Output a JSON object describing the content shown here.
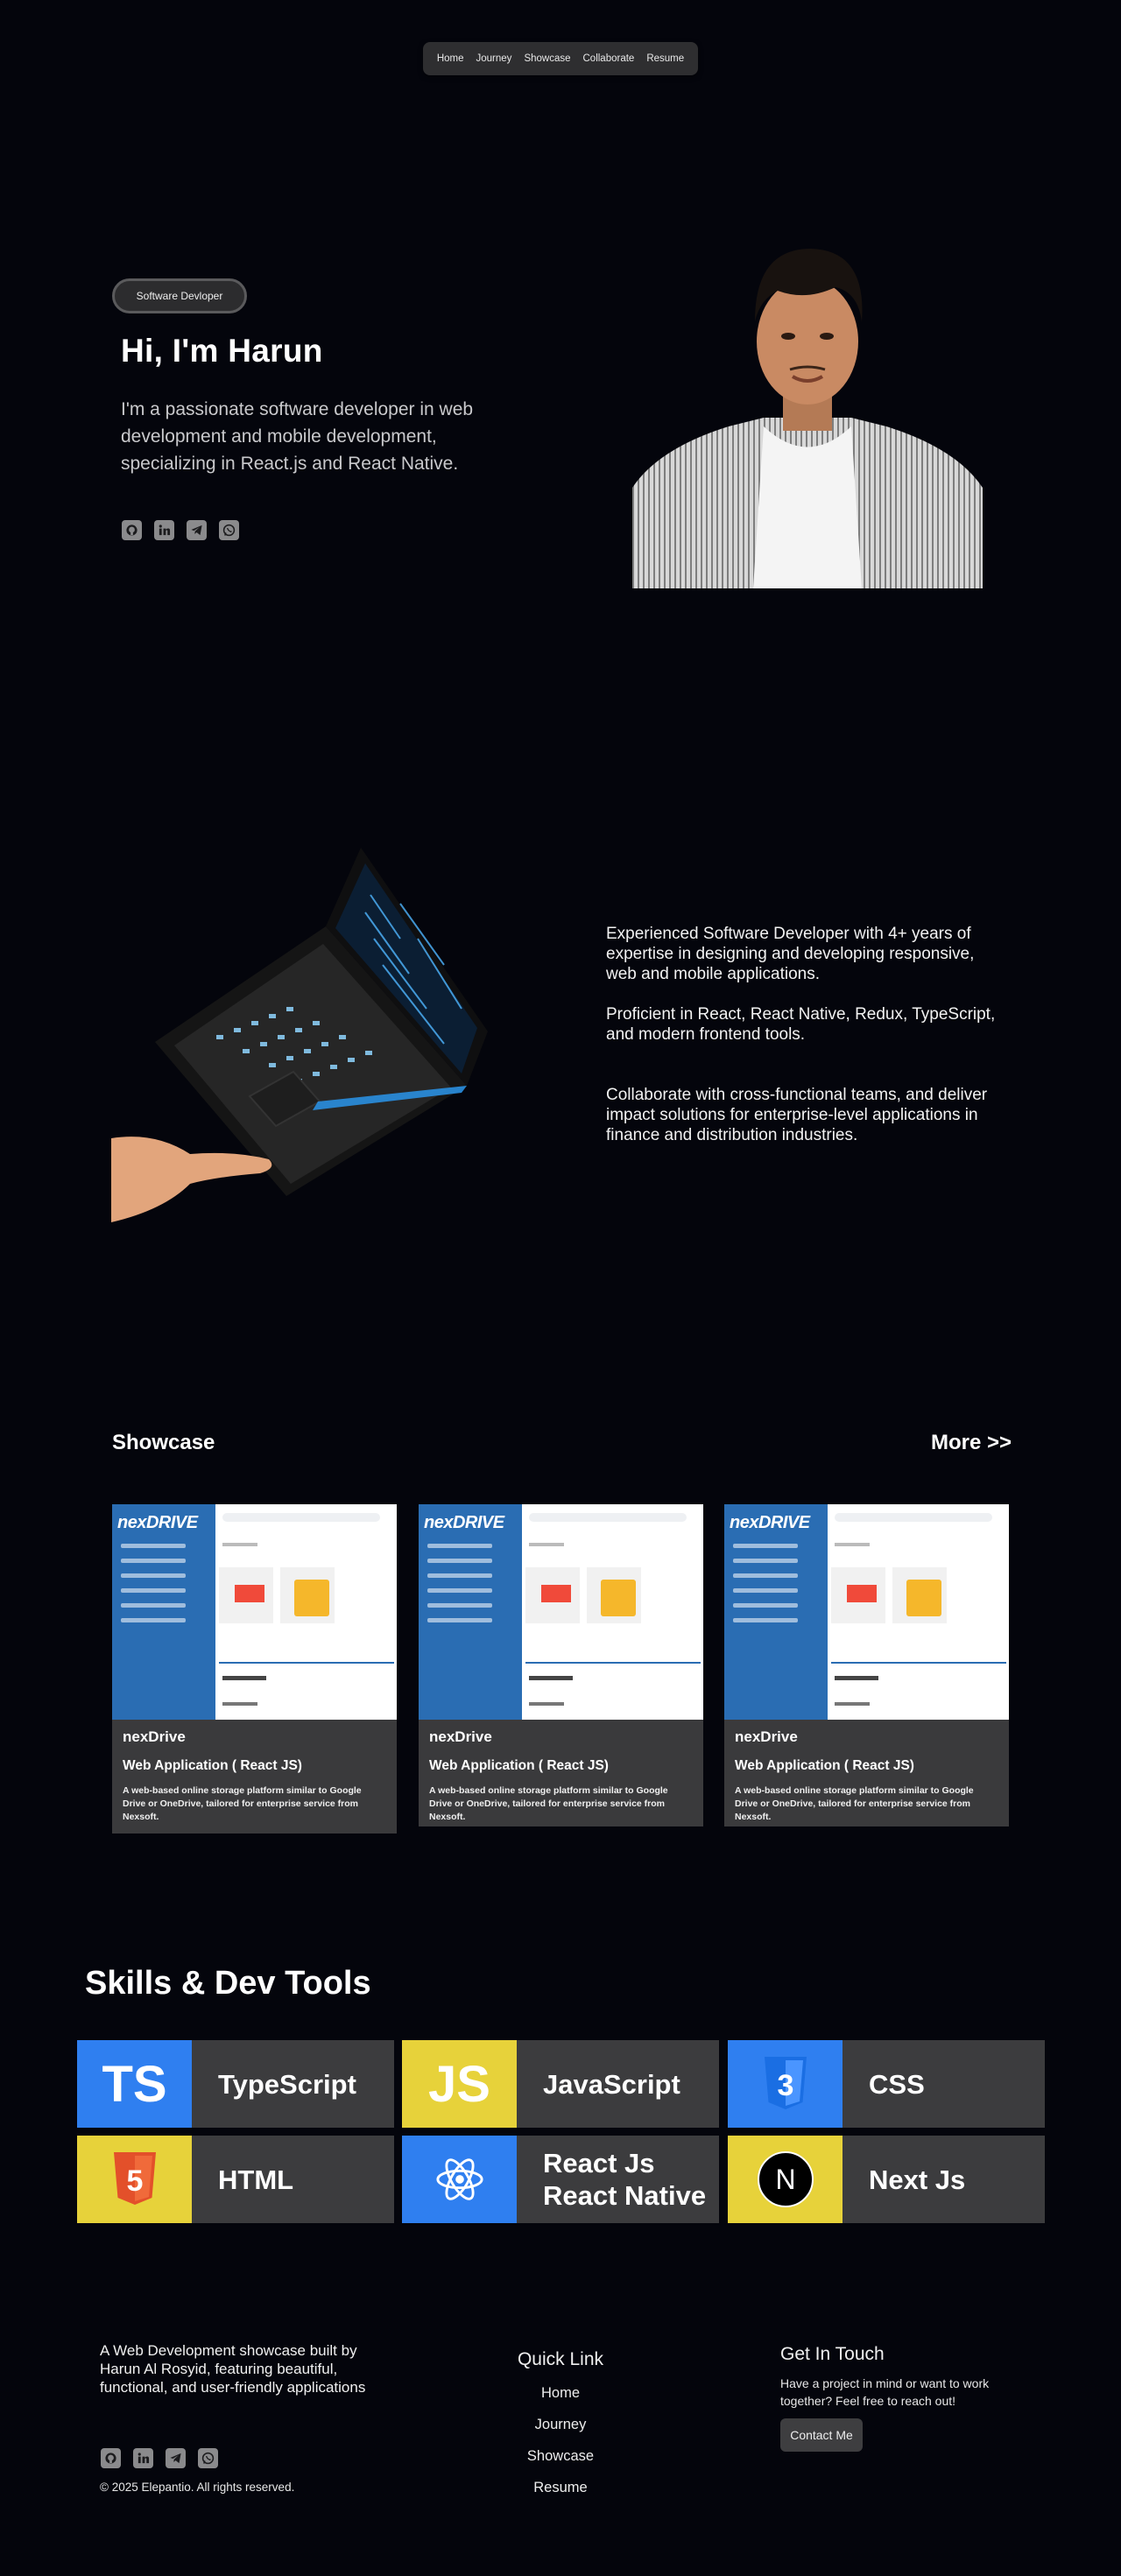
{
  "nav": {
    "items": [
      "Home",
      "Journey",
      "Showcase",
      "Collaborate",
      "Resume"
    ]
  },
  "hero": {
    "badge": "Software Devloper",
    "greeting": "Hi, I'm Harun",
    "intro": "I'm a passionate software developer in web development and mobile development, specializing in React.js and React Native.",
    "socials": [
      "github-icon",
      "linkedin-icon",
      "telegram-icon",
      "whatsapp-icon"
    ]
  },
  "about": {
    "paragraphs": [
      "Experienced Software Developer with 4+ years of expertise in designing and developing responsive, web and mobile applications.",
      "Proficient in React, React Native, Redux, TypeScript, and modern frontend tools.",
      "Collaborate with cross-functional teams, and deliver impact solutions for enterprise-level applications in finance and distribution industries."
    ]
  },
  "showcase": {
    "title": "Showcase",
    "more": "More >>",
    "cards": [
      {
        "logo": "nexDRIVE",
        "name": "nexDrive",
        "type": "Web Application ( React JS)",
        "desc": "A web-based online storage platform similar to Google Drive or OneDrive, tailored for enterprise service from Nexsoft."
      },
      {
        "logo": "nexDRIVE",
        "name": "nexDrive",
        "type": "Web Application ( React JS)",
        "desc": "A web-based online storage platform similar to Google Drive or OneDrive, tailored for enterprise service from Nexsoft."
      },
      {
        "logo": "nexDRIVE",
        "name": "nexDrive",
        "type": "Web Application ( React JS)",
        "desc": "A web-based online storage platform similar to Google Drive or OneDrive, tailored for enterprise service from Nexsoft."
      }
    ]
  },
  "skills": {
    "title": "Skills & Dev Tools",
    "items": [
      {
        "label": "TypeScript",
        "icon_text": "TS",
        "icon": "typescript-icon",
        "color": "#2f7ff0"
      },
      {
        "label": "JavaScript",
        "icon_text": "JS",
        "icon": "javascript-icon",
        "color": "#e7d23a"
      },
      {
        "label": "CSS",
        "icon_text": "3",
        "icon": "css-icon",
        "color": "#2f7ff0"
      },
      {
        "label": "HTML",
        "icon_text": "5",
        "icon": "html-icon",
        "color": "#e7d23a"
      },
      {
        "label": "React Js\nReact Native",
        "icon_text": "",
        "icon": "react-icon",
        "color": "#2f7ff0"
      },
      {
        "label": "Next Js",
        "icon_text": "N",
        "icon": "nextjs-icon",
        "color": "#e7d23a"
      }
    ]
  },
  "footer": {
    "description": "A Web Development showcase built by Harun Al Rosyid, featuring beautiful, functional, and user-friendly applications",
    "copyright": "© 2025 Elepantio. All rights reserved.",
    "quick_link_title": "Quick Link",
    "quick_links": [
      "Home",
      "Journey",
      "Showcase",
      "Resume"
    ],
    "get_in_touch_title": "Get In Touch",
    "get_in_touch_text": "Have a project in mind or want to work together? Feel free to reach out!",
    "contact_button": "Contact Me"
  }
}
